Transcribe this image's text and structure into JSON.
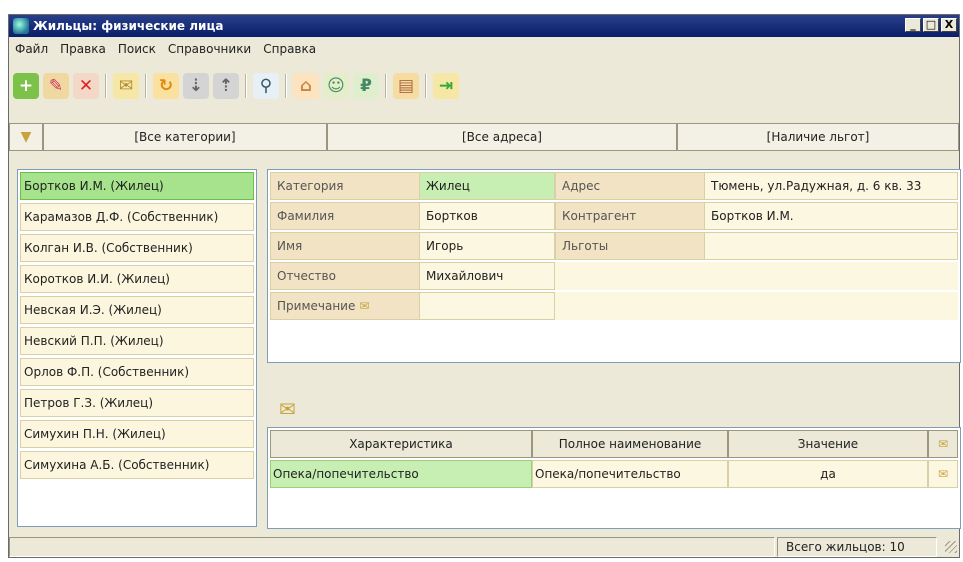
{
  "window": {
    "title": "Жильцы: физические лица"
  },
  "window_buttons": {
    "minimize": "_",
    "maximize": "□",
    "close": "X"
  },
  "menu": [
    "Файл",
    "Правка",
    "Поиск",
    "Справочники",
    "Справка"
  ],
  "toolbar_icons": [
    "add-icon",
    "edit-icon",
    "delete-icon",
    "note-icon",
    "refresh-icon",
    "db-import-icon",
    "db-export-icon",
    "search-icon",
    "house-icon",
    "people-icon",
    "money-icon",
    "book-icon",
    "exit-icon"
  ],
  "filters": {
    "icon": "filter-icon",
    "categories": "[Все категории]",
    "addresses": "[Все адреса]",
    "benefits": "[Наличие льгот]"
  },
  "residents": [
    "Бортков И.М.  (Жилец)",
    "Карамазов Д.Ф.  (Собственник)",
    "Колган И.В.  (Собственник)",
    "Коротков И.И.  (Жилец)",
    "Невская И.Э.  (Жилец)",
    "Невский П.П.  (Жилец)",
    "Орлов Ф.П.  (Собственник)",
    "Петров Г.З.  (Жилец)",
    "Симухин П.Н.  (Жилец)",
    "Симухина А.Б.  (Собственник)"
  ],
  "details": {
    "category_label": "Категория",
    "category_value": "Жилец",
    "address_label": "Адрес",
    "address_value": "Тюмень, ул.Радужная, д. 6 кв. 33",
    "surname_label": "Фамилия",
    "surname_value": "Бортков",
    "counterparty_label": "Контрагент",
    "counterparty_value": "Бортков И.М.",
    "name_label": "Имя",
    "name_value": "Игорь",
    "benefits_label": "Льготы",
    "benefits_value": "",
    "patronymic_label": "Отчество",
    "patronymic_value": "Михайлович",
    "note_label": "Примечание",
    "note_value": ""
  },
  "grid": {
    "headers": [
      "Характеристика",
      "Полное наименование",
      "Значение"
    ],
    "rows": [
      {
        "characteristic": "Опека/попечительство",
        "full_name": "Опека/попечительство",
        "value": "да"
      }
    ]
  },
  "status": {
    "total": "Всего жильцов: 10"
  },
  "colors": {
    "selected": "#a6e38c",
    "title_bar": "#0a1f6a",
    "label_bg": "#f1e3c4",
    "value_bg": "#fcf7e0"
  }
}
